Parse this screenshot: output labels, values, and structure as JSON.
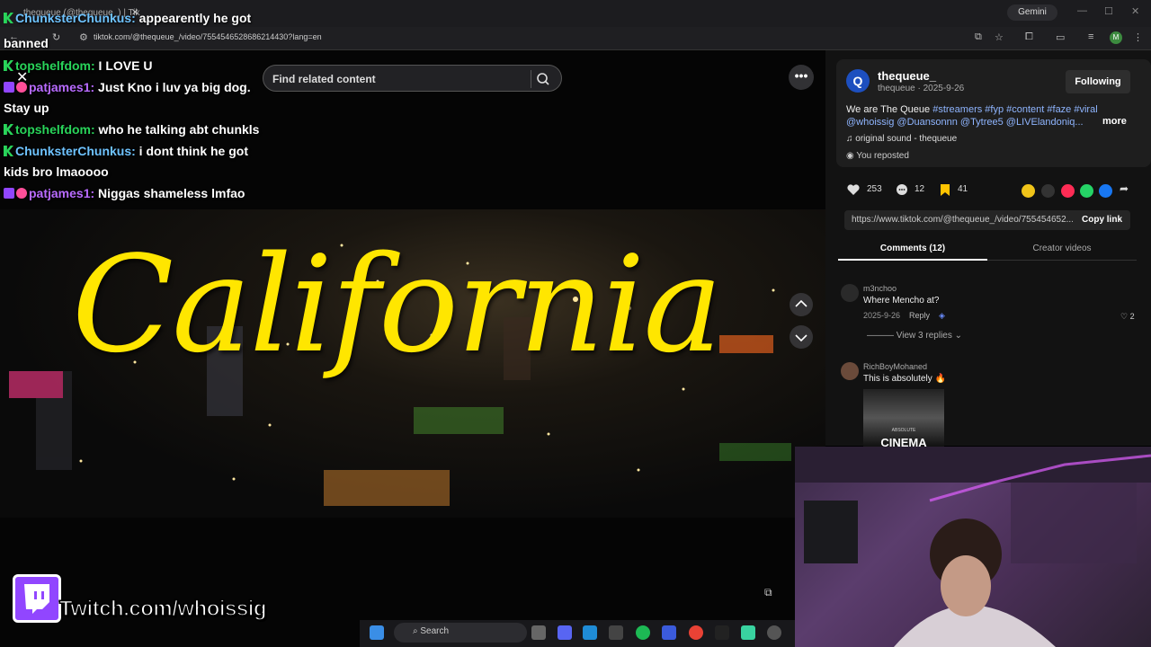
{
  "browser": {
    "tab_title": "thequeue (@thequeue_) | Tik",
    "url": "tiktok.com/@thequeue_/video/7554546528686214430?lang=en",
    "gemini_label": "Gemini",
    "profile_initial": "M"
  },
  "video": {
    "search_placeholder": "Find related content",
    "overlay_title": "California",
    "more_label": "•••"
  },
  "chat": [
    {
      "name": "ChunksterChunkus:",
      "text": " appearently he got",
      "style": "c",
      "badge": "k"
    },
    {
      "name": "",
      "text": "banned",
      "style": "",
      "badge": ""
    },
    {
      "name": "topshelfdom:",
      "text": " I LOVE U",
      "style": "k",
      "badge": "k"
    },
    {
      "name": "patjames1:",
      "text": " Just Kno i luv ya big dog.",
      "style": "p",
      "badge": "p"
    },
    {
      "name": "",
      "text": "Stay up",
      "style": "",
      "badge": ""
    },
    {
      "name": "topshelfdom:",
      "text": " who he talking abt chunkls",
      "style": "k",
      "badge": "k"
    },
    {
      "name": "ChunksterChunkus:",
      "text": " i dont think he got",
      "style": "c",
      "badge": "k"
    },
    {
      "name": "",
      "text": "kids bro lmaoooo",
      "style": "",
      "badge": ""
    },
    {
      "name": "patjames1:",
      "text": " Niggas shameless lmfao",
      "style": "p",
      "badge": "p"
    }
  ],
  "post": {
    "author": "thequeue_",
    "author_meta": "thequeue · 2025-9-26",
    "follow_label": "Following",
    "desc_prefix": "We are The Queue ",
    "desc_tags": "#streamers #fyp #content #faze #viral",
    "desc_mentions": "@whoissig @Duansonnn @Tytree5 @LIVElandoniq...",
    "more_label": "more",
    "sound": "original sound - thequeue",
    "reposted": "You reposted",
    "likes": "253",
    "comments": "12",
    "saves": "41",
    "link": "https://www.tiktok.com/@thequeue_/video/755454652...",
    "copy_label": "Copy link",
    "tab_comments": "Comments (12)",
    "tab_creator": "Creator videos"
  },
  "comments": [
    {
      "user": "m3nchoo",
      "text": "Where Mencho at?",
      "date": "2025-9-26",
      "reply": "Reply",
      "likes": "2",
      "view_replies": "View 3 replies"
    },
    {
      "user": "RichBoyMohaned",
      "text": "This is absolutely 🔥",
      "image_caption": "CINEMA",
      "image_sub": "ABSOLUTE"
    }
  ],
  "twitch": {
    "url": "Twitch.com/whoissig"
  },
  "taskbar": {
    "search_label": "Search"
  },
  "colors": {
    "accent_tag": "#8fb5ff",
    "twitch_purple": "#9146ff",
    "kick_green": "#29d45a",
    "title_yellow": "#ffe600"
  }
}
